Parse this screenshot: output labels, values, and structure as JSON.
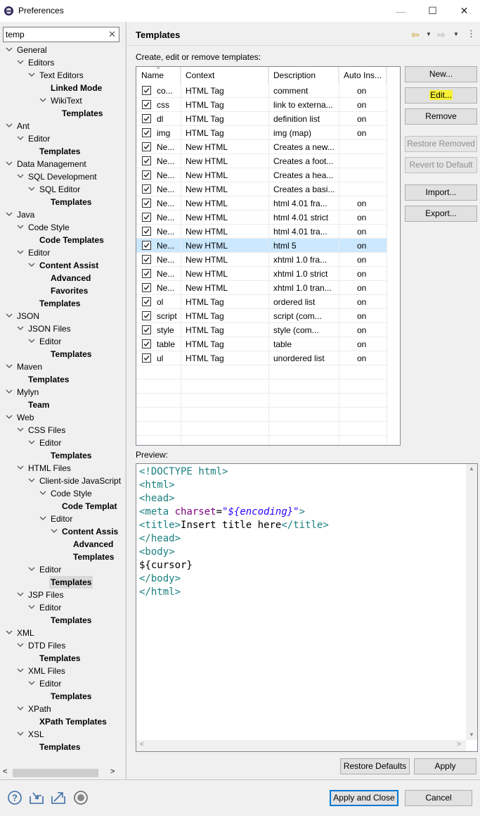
{
  "window": {
    "title": "Preferences",
    "minimize": "—",
    "maximize": "☐",
    "close": "✕"
  },
  "filter": {
    "value": "temp",
    "clear": "✕"
  },
  "tree": [
    {
      "label": "General",
      "level": 0,
      "expanded": true
    },
    {
      "label": "Editors",
      "level": 1,
      "expanded": true
    },
    {
      "label": "Text Editors",
      "level": 2,
      "expanded": true
    },
    {
      "label": "Linked Mode",
      "level": 3,
      "bold": true
    },
    {
      "label": "WikiText",
      "level": 3,
      "expanded": true
    },
    {
      "label": "Templates",
      "level": 4,
      "bold": true
    },
    {
      "label": "Ant",
      "level": 0,
      "expanded": true
    },
    {
      "label": "Editor",
      "level": 1,
      "expanded": true
    },
    {
      "label": "Templates",
      "level": 2,
      "bold": true
    },
    {
      "label": "Data Management",
      "level": 0,
      "expanded": true
    },
    {
      "label": "SQL Development",
      "level": 1,
      "expanded": true
    },
    {
      "label": "SQL Editor",
      "level": 2,
      "expanded": true
    },
    {
      "label": "Templates",
      "level": 3,
      "bold": true
    },
    {
      "label": "Java",
      "level": 0,
      "expanded": true
    },
    {
      "label": "Code Style",
      "level": 1,
      "expanded": true
    },
    {
      "label": "Code Templates",
      "level": 2,
      "bold": true
    },
    {
      "label": "Editor",
      "level": 1,
      "expanded": true
    },
    {
      "label": "Content Assist",
      "level": 2,
      "expanded": true,
      "bold": true
    },
    {
      "label": "Advanced",
      "level": 3,
      "bold": true
    },
    {
      "label": "Favorites",
      "level": 3,
      "bold": true
    },
    {
      "label": "Templates",
      "level": 2,
      "bold": true
    },
    {
      "label": "JSON",
      "level": 0,
      "expanded": true
    },
    {
      "label": "JSON Files",
      "level": 1,
      "expanded": true
    },
    {
      "label": "Editor",
      "level": 2,
      "expanded": true
    },
    {
      "label": "Templates",
      "level": 3,
      "bold": true
    },
    {
      "label": "Maven",
      "level": 0,
      "expanded": true
    },
    {
      "label": "Templates",
      "level": 1,
      "bold": true
    },
    {
      "label": "Mylyn",
      "level": 0,
      "expanded": true
    },
    {
      "label": "Team",
      "level": 1,
      "bold": true
    },
    {
      "label": "Web",
      "level": 0,
      "expanded": true
    },
    {
      "label": "CSS Files",
      "level": 1,
      "expanded": true
    },
    {
      "label": "Editor",
      "level": 2,
      "expanded": true
    },
    {
      "label": "Templates",
      "level": 3,
      "bold": true
    },
    {
      "label": "HTML Files",
      "level": 1,
      "expanded": true
    },
    {
      "label": "Client-side JavaScript",
      "level": 2,
      "expanded": true
    },
    {
      "label": "Code Style",
      "level": 3,
      "expanded": true
    },
    {
      "label": "Code Templat",
      "level": 4,
      "bold": true
    },
    {
      "label": "Editor",
      "level": 3,
      "expanded": true
    },
    {
      "label": "Content Assis",
      "level": 4,
      "expanded": true,
      "bold": true
    },
    {
      "label": "Advanced",
      "level": 5,
      "bold": true
    },
    {
      "label": "Templates",
      "level": 5,
      "bold": true
    },
    {
      "label": "Editor",
      "level": 2,
      "expanded": true
    },
    {
      "label": "Templates",
      "level": 3,
      "bold": true,
      "selected": true
    },
    {
      "label": "JSP Files",
      "level": 1,
      "expanded": true
    },
    {
      "label": "Editor",
      "level": 2,
      "expanded": true
    },
    {
      "label": "Templates",
      "level": 3,
      "bold": true
    },
    {
      "label": "XML",
      "level": 0,
      "expanded": true
    },
    {
      "label": "DTD Files",
      "level": 1,
      "expanded": true
    },
    {
      "label": "Templates",
      "level": 2,
      "bold": true
    },
    {
      "label": "XML Files",
      "level": 1,
      "expanded": true
    },
    {
      "label": "Editor",
      "level": 2,
      "expanded": true
    },
    {
      "label": "Templates",
      "level": 3,
      "bold": true
    },
    {
      "label": "XPath",
      "level": 1,
      "expanded": true
    },
    {
      "label": "XPath Templates",
      "level": 2,
      "bold": true
    },
    {
      "label": "XSL",
      "level": 1,
      "expanded": true
    },
    {
      "label": "Templates",
      "level": 2,
      "bold": true
    }
  ],
  "tree_scroll": {
    "left": "<",
    "right": ">"
  },
  "page": {
    "title": "Templates",
    "subtitle": "Create, edit or remove templates:"
  },
  "table": {
    "columns": [
      "Name",
      "Context",
      "Description",
      "Auto Ins..."
    ],
    "sort_indicator": "^",
    "rows": [
      {
        "name": "co...",
        "context": "HTML Tag",
        "description": "comment",
        "auto": "on",
        "checked": true
      },
      {
        "name": "css",
        "context": "HTML Tag",
        "description": "link to externa...",
        "auto": "on",
        "checked": true
      },
      {
        "name": "dl",
        "context": "HTML Tag",
        "description": "definition list",
        "auto": "on",
        "checked": true
      },
      {
        "name": "img",
        "context": "HTML Tag",
        "description": "img      (map)",
        "auto": "on",
        "checked": true
      },
      {
        "name": "Ne...",
        "context": "New HTML",
        "description": "Creates a new...",
        "auto": "",
        "checked": true
      },
      {
        "name": "Ne...",
        "context": "New HTML",
        "description": "Creates a foot...",
        "auto": "",
        "checked": true
      },
      {
        "name": "Ne...",
        "context": "New HTML",
        "description": "Creates a hea...",
        "auto": "",
        "checked": true
      },
      {
        "name": "Ne...",
        "context": "New HTML",
        "description": "Creates a basi...",
        "auto": "",
        "checked": true
      },
      {
        "name": "Ne...",
        "context": "New HTML",
        "description": "html 4.01 fra...",
        "auto": "on",
        "checked": true
      },
      {
        "name": "Ne...",
        "context": "New HTML",
        "description": "html 4.01 strict",
        "auto": "on",
        "checked": true
      },
      {
        "name": "Ne...",
        "context": "New HTML",
        "description": "html 4.01 tra...",
        "auto": "on",
        "checked": true
      },
      {
        "name": "Ne...",
        "context": "New HTML",
        "description": "html 5",
        "auto": "on",
        "checked": true,
        "selected": true
      },
      {
        "name": "Ne...",
        "context": "New HTML",
        "description": "xhtml 1.0 fra...",
        "auto": "on",
        "checked": true
      },
      {
        "name": "Ne...",
        "context": "New HTML",
        "description": "xhtml 1.0 strict",
        "auto": "on",
        "checked": true
      },
      {
        "name": "Ne...",
        "context": "New HTML",
        "description": "xhtml 1.0 tran...",
        "auto": "on",
        "checked": true
      },
      {
        "name": "ol",
        "context": "HTML Tag",
        "description": "ordered list",
        "auto": "on",
        "checked": true
      },
      {
        "name": "script",
        "context": "HTML Tag",
        "description": "script      (com...",
        "auto": "on",
        "checked": true
      },
      {
        "name": "style",
        "context": "HTML Tag",
        "description": "style      (com...",
        "auto": "on",
        "checked": true
      },
      {
        "name": "table",
        "context": "HTML Tag",
        "description": "table",
        "auto": "on",
        "checked": true
      },
      {
        "name": "ul",
        "context": "HTML Tag",
        "description": "unordered list",
        "auto": "on",
        "checked": true
      }
    ]
  },
  "buttons": {
    "new": "New...",
    "edit": "Edit...",
    "remove": "Remove",
    "restore_removed": "Restore Removed",
    "revert_default": "Revert to Default",
    "import": "Import...",
    "export": "Export...",
    "restore_defaults": "Restore Defaults",
    "apply": "Apply",
    "apply_close": "Apply and Close",
    "cancel": "Cancel"
  },
  "preview": {
    "label": "Preview:",
    "lines": [
      [
        {
          "t": "tag",
          "s": "<!DOCTYPE html>"
        }
      ],
      [
        {
          "t": "tag",
          "s": "<html>"
        }
      ],
      [
        {
          "t": "tag",
          "s": "<head>"
        }
      ],
      [
        {
          "t": "tag",
          "s": "<meta "
        },
        {
          "t": "attr",
          "s": "charset"
        },
        {
          "t": "txt",
          "s": "="
        },
        {
          "t": "val",
          "s": "\"${encoding}\""
        },
        {
          "t": "tag",
          "s": ">"
        }
      ],
      [
        {
          "t": "tag",
          "s": "<title>"
        },
        {
          "t": "txt",
          "s": "Insert title here"
        },
        {
          "t": "tag",
          "s": "</title>"
        }
      ],
      [
        {
          "t": "tag",
          "s": "</head>"
        }
      ],
      [
        {
          "t": "tag",
          "s": "<body>"
        }
      ],
      [
        {
          "t": "txt",
          "s": "${cursor}"
        }
      ],
      [
        {
          "t": "tag",
          "s": "</body>"
        }
      ],
      [
        {
          "t": "tag",
          "s": "</html>"
        }
      ]
    ]
  },
  "icons": {
    "help": "question-icon",
    "import": "import-prefs-icon",
    "export": "export-prefs-icon",
    "record": "oomph-record-icon"
  },
  "colors": {
    "selection": "#cce8ff",
    "highlight": "#f7f236",
    "tag": "#1a7f7f",
    "attr": "#7f007f",
    "value": "#2a00ff"
  }
}
